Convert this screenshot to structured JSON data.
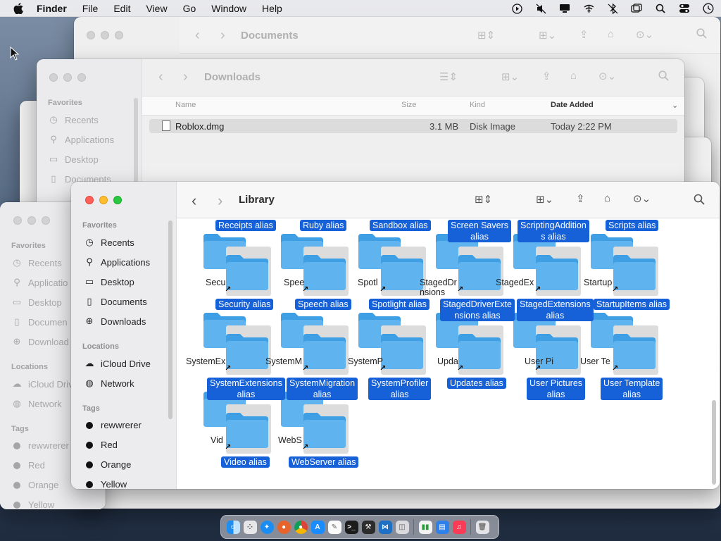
{
  "menubar": {
    "app": "Finder",
    "items": [
      "File",
      "Edit",
      "View",
      "Go",
      "Window",
      "Help"
    ],
    "status_icons": [
      "play-circle-icon",
      "mute-icon",
      "display-icon",
      "wifi-off-icon",
      "bluetooth-off-icon",
      "window-switch-icon",
      "search-icon",
      "control-center-icon",
      "clock-icon"
    ]
  },
  "documents_window": {
    "title": "Documents"
  },
  "downloads_window": {
    "title": "Downloads",
    "sidebar": {
      "heading": "Favorites",
      "items": [
        "Recents",
        "Applications",
        "Desktop",
        "Documents"
      ]
    },
    "columns": {
      "name": "Name",
      "size": "Size",
      "kind": "Kind",
      "date": "Date Added"
    },
    "rows": [
      {
        "name": "Roblox.dmg",
        "size": "3.1 MB",
        "kind": "Disk Image",
        "date": "Today 2:22 PM"
      }
    ]
  },
  "left_window": {
    "favorites_heading": "Favorites",
    "favorites": [
      "Recents",
      "Applicatio",
      "Desktop",
      "Documen",
      "Download"
    ],
    "locations_heading": "Locations",
    "locations": [
      "iCloud Driv",
      "Network"
    ],
    "tags_heading": "Tags",
    "tags": [
      "rewwrerer",
      "Red",
      "Orange",
      "Yellow"
    ]
  },
  "library_window": {
    "title": "Library",
    "sidebar": {
      "favorites_heading": "Favorites",
      "favorites": [
        "Recents",
        "Applications",
        "Desktop",
        "Documents",
        "Downloads"
      ],
      "locations_heading": "Locations",
      "locations": [
        "iCloud Drive",
        "Network"
      ],
      "tags_heading": "Tags",
      "tags": [
        "rewwrerer",
        "Red",
        "Orange",
        "Yellow"
      ]
    },
    "row1_top_labels": [
      "Receipts alias",
      "Ruby alias",
      "Sandbox alias",
      "Screen Savers\nalias",
      "ScriptingAddition\ns alias",
      "Scripts alias"
    ],
    "row1_under": [
      "Secu",
      "Spee",
      "Spotl",
      "StagedDr\nnsions",
      "StagedEx",
      "Startup"
    ],
    "row2_top_labels": [
      "Security alias",
      "Speech alias",
      "Spotlight alias",
      "StagedDriverExte\nnsions alias",
      "StagedExtensions\nalias",
      "StartupItems alias"
    ],
    "row2_under": [
      "SystemEx",
      "SystemM",
      "SystemP",
      "Upda",
      "User Pi",
      "User Te"
    ],
    "row3_top_labels": [
      "SystemExtensions\nalias",
      "SystemMigration\nalias",
      "SystemProfiler\nalias",
      "Updates alias",
      "User Pictures\nalias",
      "User Template\nalias"
    ],
    "row3_under": [
      "Vid",
      "WebS"
    ],
    "row4_labels": [
      "Video alias",
      "WebServer alias"
    ]
  },
  "dock": {
    "apps": [
      "finder-icon",
      "launchpad-icon",
      "safari-icon",
      "firefox-icon",
      "chrome-icon",
      "app-store-icon",
      "textedit-icon",
      "terminal-icon",
      "xcode-icon",
      "vscode-icon",
      "preview-icon",
      "numbers-icon",
      "keynote-icon",
      "music-icon",
      "trash-icon"
    ]
  },
  "colors": {
    "selection": "#1660d8",
    "folder": "#5fb4ef",
    "folder_dark": "#3f9fe4"
  }
}
